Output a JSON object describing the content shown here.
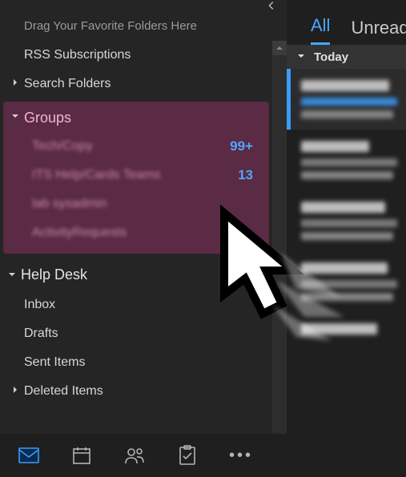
{
  "sidebar": {
    "drag_hint": "Drag Your Favorite Folders Here",
    "rss": "RSS Subscriptions",
    "search_folders": "Search Folders",
    "groups": {
      "label": "Groups",
      "items": [
        {
          "label": "Tech/Copy",
          "count": "99+"
        },
        {
          "label": "ITS Help/Cards Teams",
          "count": "13"
        },
        {
          "label": "lab sysadmin",
          "count": ""
        },
        {
          "label": "ActivityRequests",
          "count": ""
        }
      ]
    },
    "helpdesk": {
      "label": "Help Desk",
      "items": [
        {
          "label": "Inbox"
        },
        {
          "label": "Drafts"
        },
        {
          "label": "Sent Items"
        },
        {
          "label": "Deleted Items"
        }
      ]
    }
  },
  "tabs": {
    "all": "All",
    "unread": "Unread"
  },
  "date_section": "Today",
  "colors": {
    "accent": "#4da6ff",
    "groups_bg": "#5b2a44"
  }
}
